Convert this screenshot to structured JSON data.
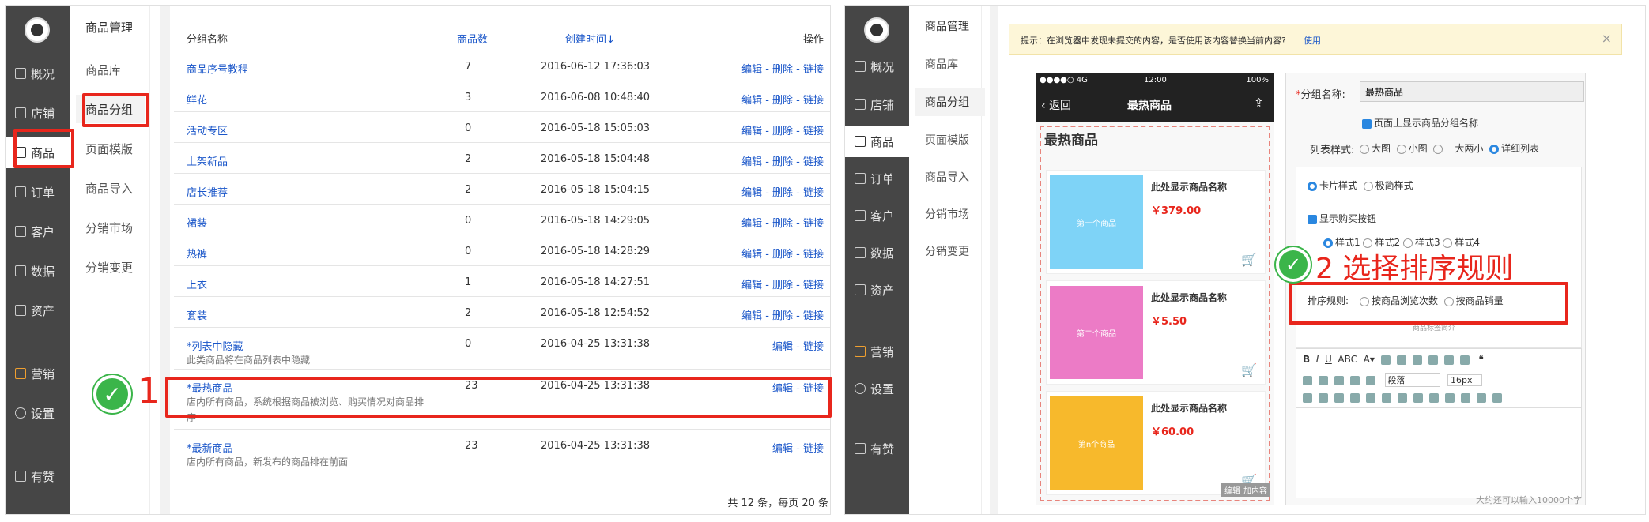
{
  "left": {
    "nav": [
      {
        "label": "概况",
        "icon": "overview-icon"
      },
      {
        "label": "店铺",
        "icon": "shop-icon"
      },
      {
        "label": "商品",
        "icon": "tag-icon"
      },
      {
        "label": "订单",
        "icon": "order-icon"
      },
      {
        "label": "客户",
        "icon": "user-icon"
      },
      {
        "label": "数据",
        "icon": "chart-icon"
      },
      {
        "label": "资产",
        "icon": "yuan-icon"
      },
      {
        "label": "营销",
        "icon": "marketing-icon"
      },
      {
        "label": "设置",
        "icon": "gear-icon"
      },
      {
        "label": "有赞",
        "icon": "thumb-icon"
      }
    ],
    "sub": {
      "header": "商品管理",
      "items": [
        "商品库",
        "商品分组",
        "页面模版",
        "商品导入",
        "分销市场",
        "分销变更"
      ]
    },
    "table": {
      "headers": {
        "name": "分组名称",
        "count": "商品数",
        "created": "创建时间↓",
        "ops": "操作"
      },
      "rows": [
        {
          "name": "商品序号教程",
          "count": "7",
          "created": "2016-06-12 17:36:03",
          "ops": "编辑 - 删除 - 链接"
        },
        {
          "name": "鲜花",
          "count": "3",
          "created": "2016-06-08 10:48:40",
          "ops": "编辑 - 删除 - 链接"
        },
        {
          "name": "活动专区",
          "count": "0",
          "created": "2016-05-18 15:05:03",
          "ops": "编辑 - 删除 - 链接"
        },
        {
          "name": "上架新品",
          "count": "2",
          "created": "2016-05-18 15:04:48",
          "ops": "编辑 - 删除 - 链接"
        },
        {
          "name": "店长推荐",
          "count": "2",
          "created": "2016-05-18 15:04:15",
          "ops": "编辑 - 删除 - 链接"
        },
        {
          "name": "裙装",
          "count": "0",
          "created": "2016-05-18 14:29:05",
          "ops": "编辑 - 删除 - 链接"
        },
        {
          "name": "热裤",
          "count": "0",
          "created": "2016-05-18 14:28:29",
          "ops": "编辑 - 删除 - 链接"
        },
        {
          "name": "上衣",
          "count": "1",
          "created": "2016-05-18 14:27:51",
          "ops": "编辑 - 删除 - 链接"
        },
        {
          "name": "套装",
          "count": "2",
          "created": "2016-05-18 12:54:52",
          "ops": "编辑 - 删除 - 链接"
        },
        {
          "name": "*列表中隐藏",
          "desc": "此类商品将在商品列表中隐藏",
          "count": "0",
          "created": "2016-04-25 13:31:38",
          "ops": "编辑 - 链接"
        },
        {
          "name": "*最热商品",
          "desc": "店内所有商品，系统根据商品被浏览、购买情况对商品排",
          "desc2": "序",
          "count": "23",
          "created": "2016-04-25 13:31:38",
          "ops": "编辑 - 链接"
        },
        {
          "name": "*最新商品",
          "desc": "店内所有商品，新发布的商品排在前面",
          "count": "23",
          "created": "2016-04-25 13:31:38",
          "ops": "编辑 - 链接"
        }
      ],
      "footer": "共 12 条，每页 20 条"
    },
    "step_number": "1"
  },
  "right": {
    "notice": {
      "text": "提示：在浏览器中发现未提交的内容，是否使用该内容替换当前内容?",
      "link": "使用",
      "close": "×"
    },
    "phone": {
      "status_left": "●●●●○ 4G",
      "status_time": "12:00",
      "status_right": "100%",
      "back": "返回",
      "title": "最热商品",
      "heading": "最热商品",
      "products": [
        {
          "thumb": "第一个商品",
          "name": "此处显示商品名称",
          "price": "￥379.00",
          "color": "#7ed3f7"
        },
        {
          "thumb": "第二个商品",
          "name": "此处显示商品名称",
          "price": "￥5.50",
          "color": "#ec7bc6"
        },
        {
          "thumb": "第n个商品",
          "name": "此处显示商品名称",
          "price": "￥60.00",
          "color": "#f7b92c"
        }
      ],
      "edit": "编辑",
      "add": "加内容"
    },
    "form": {
      "name_label": "分组名称:",
      "name_value": "最热商品",
      "show_name": "页面上显示商品分组名称",
      "list_style_label": "列表样式:",
      "list_styles": [
        "大图",
        "小图",
        "一大两小",
        "详细列表"
      ],
      "card_styles": [
        "卡片样式",
        "极简样式"
      ],
      "show_buy": "显示购买按钮",
      "buy_styles": [
        "样式1",
        "样式2",
        "样式3",
        "样式4"
      ],
      "sort_label": "排序规则:",
      "sort_options": [
        "按商品浏览次数",
        "按商品销量"
      ],
      "intro_label": "商品标签简介",
      "format": "段落",
      "font_size": "16px",
      "counter": "大约还可以输入10000个字"
    },
    "step_number": "2",
    "step_text": "选择排序规则"
  }
}
